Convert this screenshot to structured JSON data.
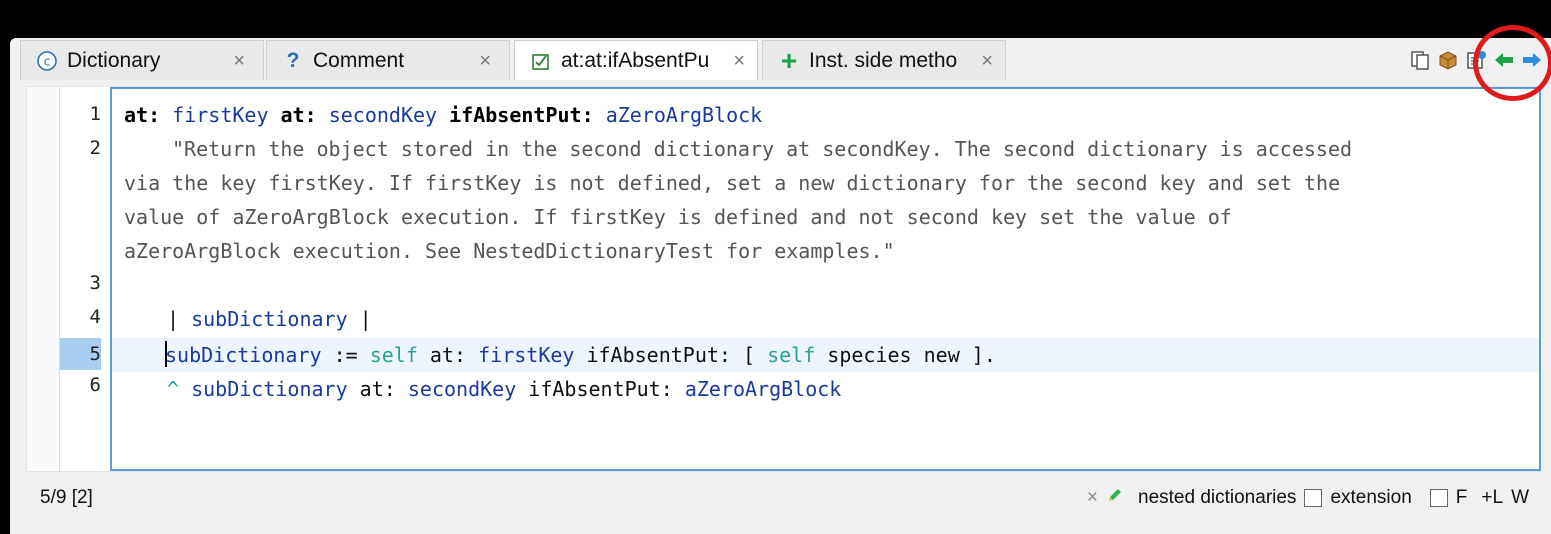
{
  "tabs": [
    {
      "label": "Dictionary",
      "icon": "class-icon",
      "close": "×"
    },
    {
      "label": "Comment",
      "icon": "question-icon",
      "icon_glyph": "?",
      "close": "×"
    },
    {
      "label": "at:at:ifAbsentPu",
      "icon": "method-icon",
      "close": "×"
    },
    {
      "label": "Inst. side metho",
      "icon": "plus-icon",
      "icon_glyph": "+",
      "close": "×"
    }
  ],
  "toolbar": {
    "icons": [
      "copy-icon",
      "package-icon",
      "browse-icon",
      "back-arrow-icon",
      "forward-arrow-icon"
    ],
    "back_color": "#1aa34a",
    "forward_color": "#2e8bd8"
  },
  "editor": {
    "line_numbers": [
      "1",
      "2",
      "3",
      "4",
      "5",
      "6"
    ],
    "current_line": "5",
    "method_signature": {
      "k1": "at:",
      "a1": "firstKey",
      "k2": "at:",
      "a2": "secondKey",
      "k3": "ifAbsentPut:",
      "a3": "aZeroArgBlock"
    },
    "comment_lines": [
      "\"Return the object stored in the second dictionary at secondKey. The second dictionary is accessed",
      "via the key firstKey. If firstKey is not defined, set a new dictionary for the second key and set the",
      "value of aZeroArgBlock execution. If firstKey is defined and not second key set the value of",
      "aZeroArgBlock execution. See NestedDictionaryTest for examples.\""
    ],
    "temps": {
      "open": "| ",
      "name": "subDictionary",
      "close": " |"
    },
    "line5": {
      "var": "subDictionary",
      "assign": " := ",
      "self1": "self",
      "msg1": " at: ",
      "arg1": "firstKey",
      "msg2": " ifAbsentPut: [ ",
      "self2": "self",
      "msg3": " species new ]."
    },
    "line6": {
      "caret": "^ ",
      "var": "subDictionary",
      "msg1": " at: ",
      "arg1": "secondKey",
      "msg2": " ifAbsentPut: ",
      "arg2": "aZeroArgBlock"
    }
  },
  "status": {
    "position": "5/9 [2]",
    "close": "×",
    "protocol": "nested dictionaries",
    "extension_label": "extension",
    "f_label": "F",
    "l_label": "+L",
    "w_label": "W"
  },
  "colors": {
    "accent": "#5b9bd5",
    "annotation": "#e0191b"
  }
}
